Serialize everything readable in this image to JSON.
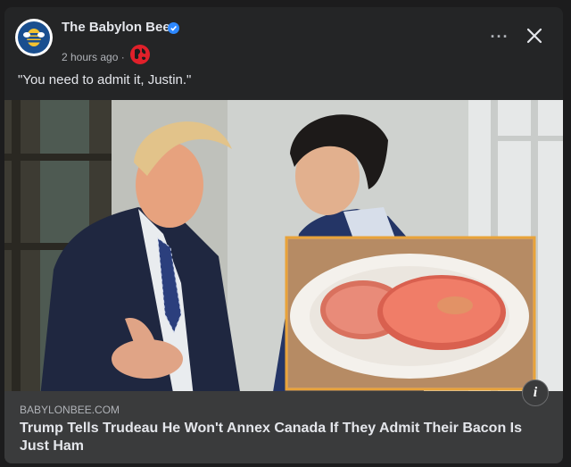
{
  "post": {
    "page_name": "The Babylon Bee",
    "timestamp": "2 hours ago",
    "separator": "·",
    "caption": "\"You need to admit it, Justin.\"",
    "more_label": "···",
    "info_label": "i"
  },
  "link_preview": {
    "domain": "BABYLONBEE.COM",
    "headline": "Trump Tells Trudeau He Won't Annex Canada If They Admit Their Bacon Is Just Ham"
  },
  "colors": {
    "card_bg": "#242526",
    "link_box_bg": "#3a3b3c",
    "verified": "#2d88ff",
    "photo_inset_border": "#e8a33a"
  },
  "icons": {
    "avatar": "babylon-bee-logo-icon",
    "verified": "verified-badge-icon",
    "audience": "globe-icon",
    "more": "more-options-icon",
    "close": "close-icon",
    "info": "info-icon"
  }
}
